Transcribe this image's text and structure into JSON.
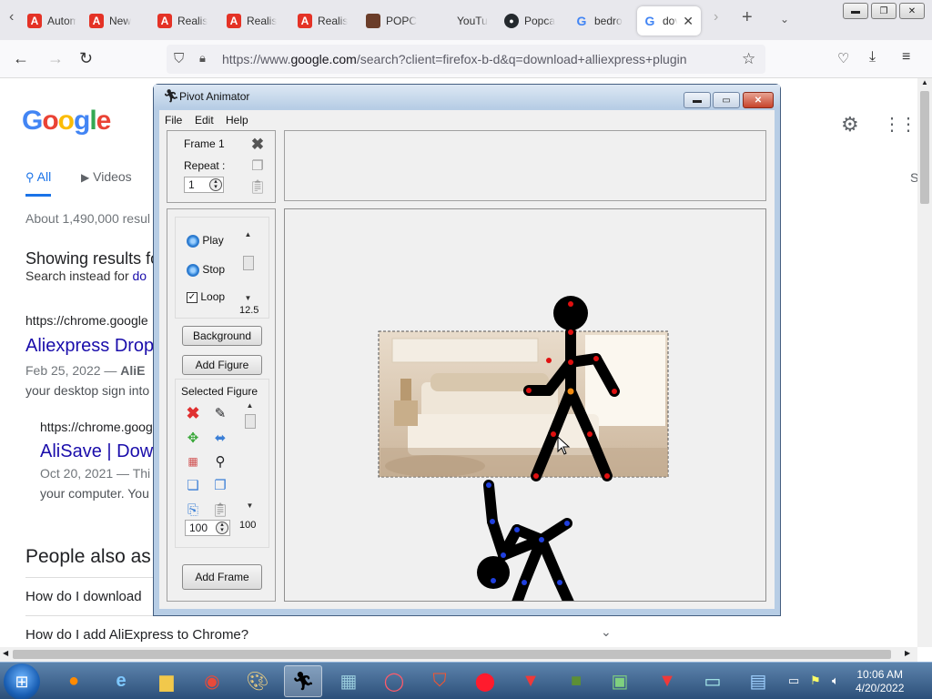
{
  "browser": {
    "tabs": [
      {
        "title": "Autom",
        "icon": "aliexpress-icon"
      },
      {
        "title": "New",
        "icon": "aliexpress-icon"
      },
      {
        "title": "Realis",
        "icon": "aliexpress-icon"
      },
      {
        "title": "Realis",
        "icon": "aliexpress-icon"
      },
      {
        "title": "Realis",
        "icon": "aliexpress-icon"
      },
      {
        "title": "POPC",
        "icon": "popcorn-icon"
      },
      {
        "title": "YouTu",
        "icon": "youtube-icon"
      },
      {
        "title": "Popca",
        "icon": "github-icon"
      },
      {
        "title": "bedro",
        "icon": "google-icon"
      },
      {
        "title": "dov",
        "icon": "google-icon",
        "active": true
      }
    ],
    "url_prefix": "https://www.",
    "url_domain": "google.com",
    "url_rest": "/search?client=firefox-b-d&q=download+alliexpress+plugin"
  },
  "google": {
    "logo_letters": [
      "G",
      "o",
      "o",
      "g",
      "l",
      "e"
    ],
    "tabs": {
      "all": "All",
      "videos": "Videos"
    },
    "right_edge_letter": "S",
    "stats": "About 1,490,000 resul",
    "showing_results": "Showing results fo",
    "search_instead_prefix": "Search instead for ",
    "search_instead_link": "do",
    "result1": {
      "url": "https://chrome.google",
      "title": "Aliexpress Drop",
      "date": "Feb 25, 2022 — ",
      "snippet_bold": "AliE",
      "snippet2": "your desktop sign into"
    },
    "result2": {
      "url": "https://chrome.goog",
      "title": "AliSave | Dow",
      "date": "Oct 20, 2021 — Thi",
      "snippet2": "your computer. You"
    },
    "people_also_ask": "People also as",
    "paa1": "How do I download",
    "paa2": "How do I add AliExpress to Chrome?"
  },
  "pivot": {
    "title": "Pivot Animator",
    "menu": {
      "file": "File",
      "edit": "Edit",
      "help": "Help"
    },
    "frame_label": "Frame 1",
    "repeat_label": "Repeat :",
    "repeat_value": "1",
    "play": "Play",
    "stop": "Stop",
    "loop": "Loop",
    "speed": "12.5",
    "background_button": "Background",
    "add_figure_button": "Add Figure",
    "selected_figure": "Selected Figure",
    "size_value": "100",
    "size_label": "100",
    "add_frame_button": "Add Frame"
  },
  "taskbar": {
    "time": "10:06 AM",
    "date": "4/20/2022"
  }
}
